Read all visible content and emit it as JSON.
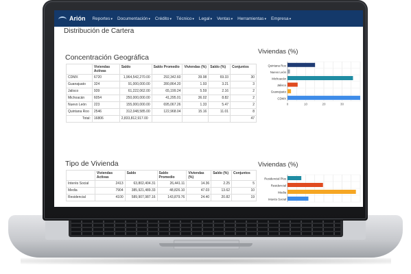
{
  "nav": {
    "brand": "Arión",
    "menu": [
      "Reportes",
      "Documentación",
      "Crédito",
      "Técnico",
      "Legal",
      "Ventas",
      "Herramientas",
      "Empresa"
    ]
  },
  "page_title": "Distribución de Cartera",
  "geo": {
    "title": "Concentración Geográfica",
    "columns": [
      "",
      "Viviendas Activas",
      "Saldo",
      "Saldo Promedio",
      "Viviendas (%)",
      "Saldo (%)",
      "Conjuntos"
    ],
    "rows": [
      [
        "CDMX",
        "6720",
        "1,964,542,270.00",
        "292,342.60",
        "39.98",
        "69.33",
        "30"
      ],
      [
        "Guanajuato",
        "324",
        "91,000,000.00",
        "280,864.20",
        "1.93",
        "3.21",
        "3"
      ],
      [
        "Jalisco",
        "939",
        "61,222,062.00",
        "65,199.24",
        "5.59",
        "2.16",
        "2"
      ],
      [
        "Michoacán",
        "6054",
        "250,000,000.00",
        "41,295.01",
        "36.02",
        "8.82",
        "2"
      ],
      [
        "Nuevo León",
        "223",
        "155,000,000.00",
        "695,067.26",
        "1.33",
        "5.47",
        "2"
      ],
      [
        "Quintana Roo",
        "2546",
        "312,048,585.00",
        "122,968.04",
        "15.16",
        "11.01",
        "8"
      ],
      [
        "Total:",
        "16806",
        "2,833,812,917.00",
        "",
        "",
        "",
        "47"
      ]
    ]
  },
  "geo_chart": {
    "title": "Viviendas (%)"
  },
  "tipo": {
    "title": "Tipo de Vivienda",
    "columns": [
      "",
      "Viviendas Activas",
      "Saldo",
      "Saldo Promedio",
      "Viviendas (%)",
      "Saldo (%)",
      "Conjuntos"
    ],
    "rows": [
      [
        "Interés Social",
        "2413",
        "63,802,404.31",
        "26,441.11",
        "14.36",
        "2.25",
        "5"
      ],
      [
        "Media",
        "7904",
        "385,921,489.33",
        "48,826.10",
        "47.03",
        "13.62",
        "10"
      ],
      [
        "Residencial",
        "4100",
        "589,907,987.16",
        "143,879.76",
        "24.40",
        "20.82",
        "19"
      ]
    ]
  },
  "tipo_chart": {
    "title": "Viviendas (%)"
  },
  "chart_data": [
    {
      "type": "bar",
      "orientation": "horizontal",
      "title": "Viviendas (%)",
      "categories": [
        "Quintana Roo",
        "Nuevo León",
        "Michoacán",
        "Jalisco",
        "Guanajuato",
        "CDMX"
      ],
      "values": [
        15.16,
        1.33,
        36.02,
        5.59,
        1.93,
        39.98
      ],
      "colors": [
        "#1f3b73",
        "#9aa3ad",
        "#1f8ca3",
        "#e04a1f",
        "#f5a623",
        "#3d8be8"
      ],
      "xticks": [
        "0",
        "10",
        "20",
        "30"
      ],
      "xlim": [
        0,
        40
      ],
      "grid": true
    },
    {
      "type": "bar",
      "orientation": "horizontal",
      "title": "Viviendas (%)",
      "categories": [
        "Residencial Plus",
        "Residencial",
        "Media",
        "Interés Social"
      ],
      "values": [
        9.5,
        24.4,
        47.03,
        14.36
      ],
      "colors": [
        "#1f8ca3",
        "#e04a1f",
        "#f5a623",
        "#3d8be8"
      ],
      "xlim": [
        0,
        50
      ],
      "grid": true
    }
  ]
}
